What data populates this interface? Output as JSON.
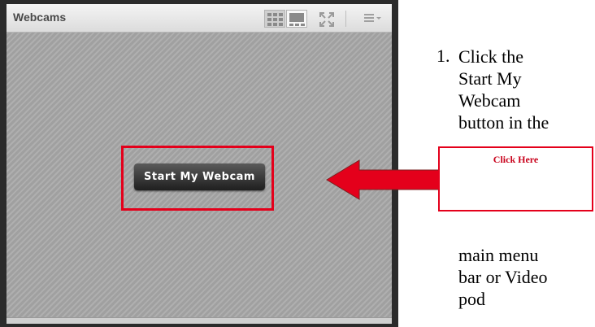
{
  "pod": {
    "title": "Webcams",
    "start_button_label": "Start My Webcam",
    "icons": [
      "grid-view-icon",
      "single-view-icon",
      "fullscreen-icon",
      "pod-menu-icon"
    ]
  },
  "callout": {
    "label": "Click Here",
    "color": "#e4001b"
  },
  "instructions": {
    "number": "1.",
    "lines": [
      "Click the",
      "Start My",
      "Webcam",
      "button in the"
    ],
    "continued_lines": [
      "main menu",
      "bar or Video",
      "pod"
    ]
  }
}
